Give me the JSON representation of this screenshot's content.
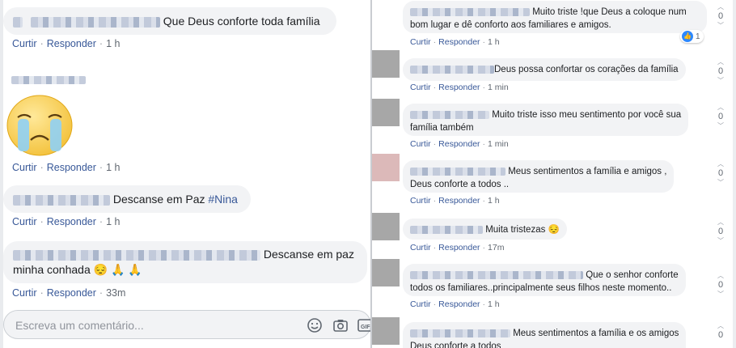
{
  "left": {
    "comments": [
      {
        "text": "Que Deus conforte toda família",
        "like": "Curtir",
        "reply": "Responder",
        "time": "1 h"
      },
      {
        "like": "Curtir",
        "reply": "Responder",
        "time": "1 h"
      },
      {
        "text": "Descanse em Paz ",
        "hashtag": "#Nina",
        "like": "Curtir",
        "reply": "Responder",
        "time": "1 h"
      },
      {
        "text": "Descanse em paz",
        "text2": "minha conhada 😔 🙏 🙏",
        "like": "Curtir",
        "reply": "Responder",
        "time": "33m"
      }
    ],
    "composer": {
      "placeholder": "Escreva um comentário..."
    }
  },
  "right": {
    "comments": [
      {
        "text": "Muito triste !que Deus a coloque num",
        "text2": "bom lugar e dê conforto aos familiares e amigos.",
        "like": "Curtir",
        "reply": "Responder",
        "time": "1 h",
        "votes": "0",
        "reactions": "1"
      },
      {
        "text": "Deus possa confortar os corações da família",
        "like": "Curtir",
        "reply": "Responder",
        "time": "1 min",
        "votes": "0"
      },
      {
        "text": "Muito triste isso meu sentimento por você sua",
        "text2": "família também",
        "like": "Curtir",
        "reply": "Responder",
        "time": "1 min",
        "votes": "0"
      },
      {
        "text": "Meus sentimentos a família e amigos ,",
        "text2": "Deus conforte a todos ..",
        "like": "Curtir",
        "reply": "Responder",
        "time": "1 h",
        "votes": "0"
      },
      {
        "text": "Muita tristezas 😔",
        "like": "Curtir",
        "reply": "Responder",
        "time": "17m",
        "votes": "0"
      },
      {
        "text": "Que o senhor conforte",
        "text2": "todos os familiares..principalmente seus filhos neste momento..",
        "like": "Curtir",
        "reply": "Responder",
        "time": "1 h",
        "votes": "0"
      },
      {
        "text": "Meus sentimentos a família e os amigos",
        "text2": "Deus conforte a todos",
        "votes": "0"
      }
    ]
  },
  "colors": {
    "link": "#385898",
    "bubble": "#f2f3f5",
    "meta": "#606770",
    "like_blue": "#2d88ff"
  },
  "icons": [
    "sad-crying-emoji-sticker",
    "emoji-icon",
    "camera-icon",
    "gif-icon",
    "thumbs-up-icon",
    "vote-up-arrow",
    "vote-down-arrow"
  ]
}
